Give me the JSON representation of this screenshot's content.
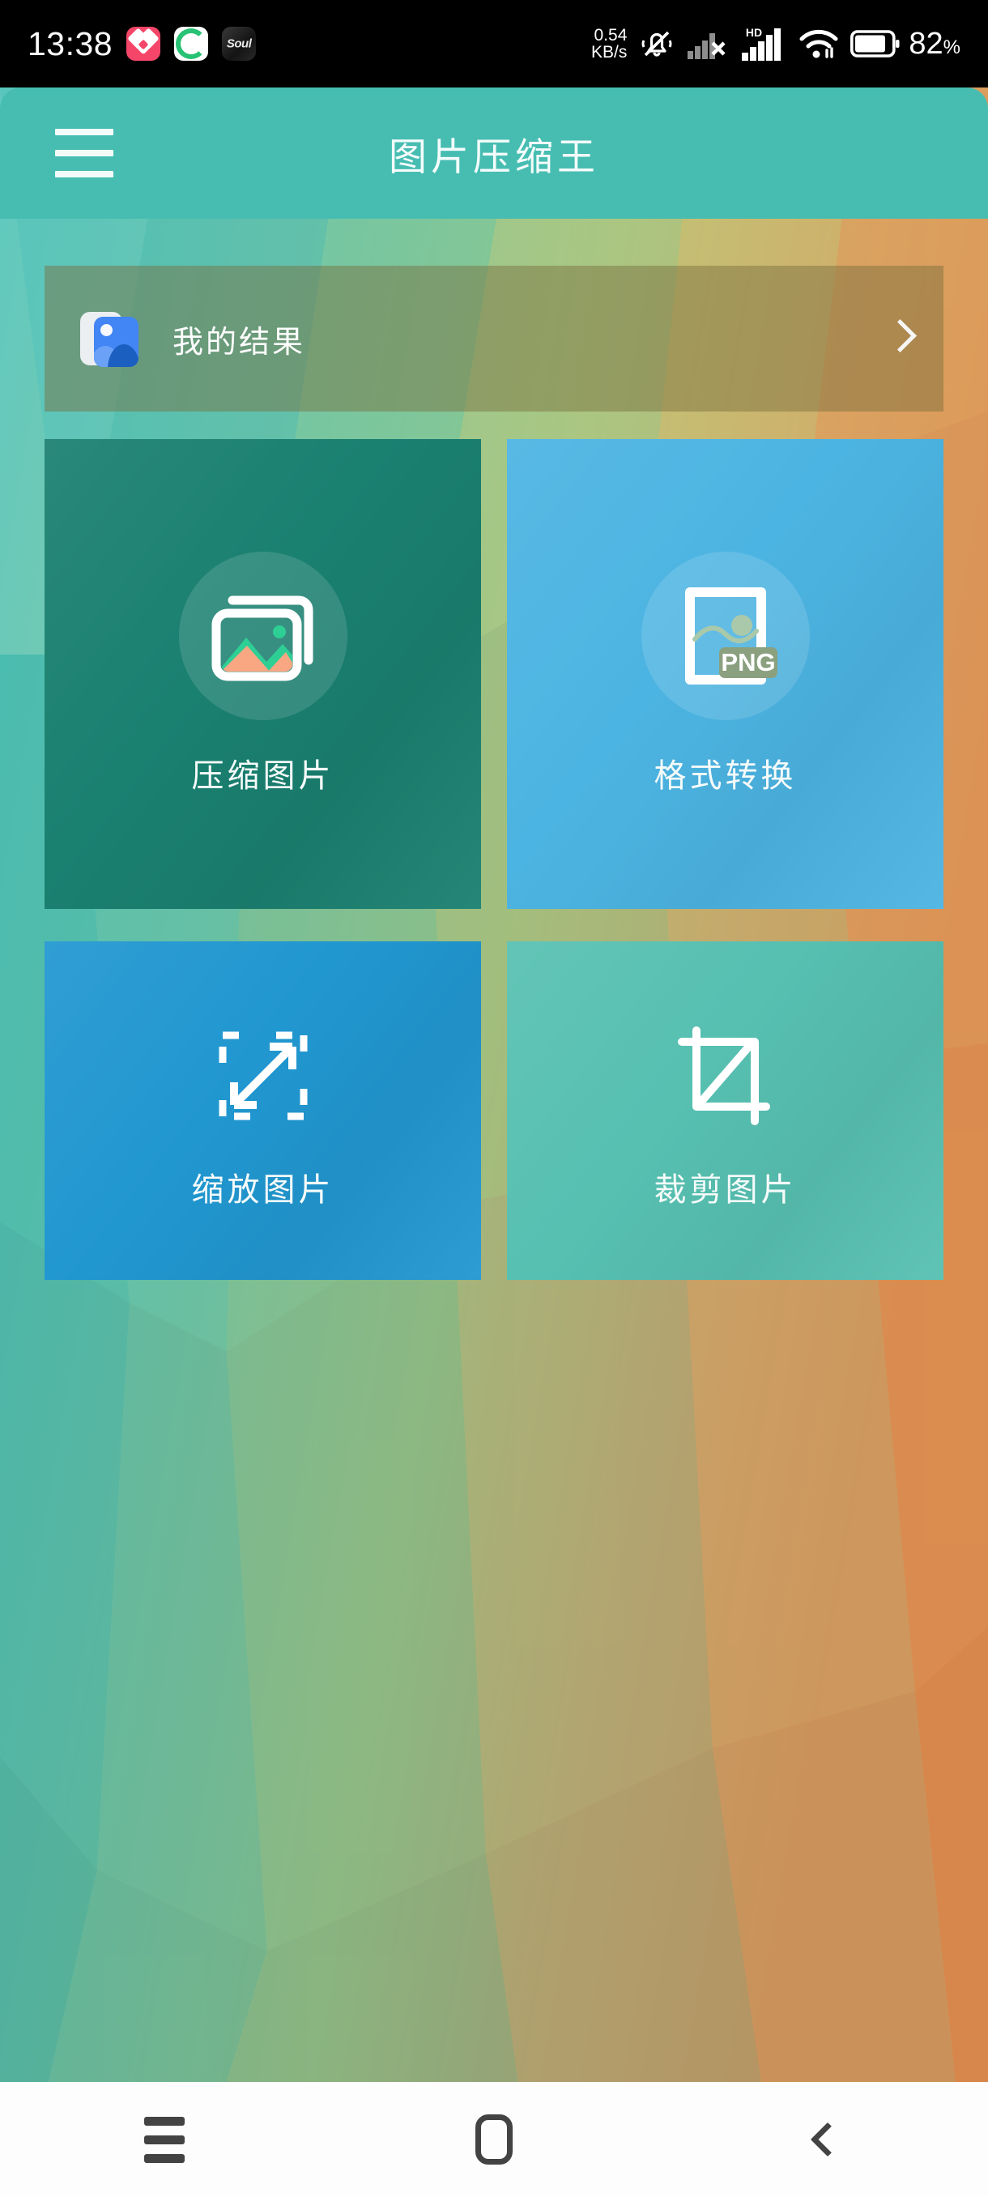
{
  "status_bar": {
    "time": "13:38",
    "app_icons": [
      "heart-app-icon",
      "green-refresh-app-icon",
      "soul-app-icon"
    ],
    "soul_label": "Soul",
    "net_speed_value": "0.54",
    "net_speed_unit": "KB/s",
    "icons": [
      "mute-bell-icon",
      "sim1-signal-no-service-icon",
      "sim2-signal-icon",
      "wifi-icon",
      "battery-icon"
    ],
    "volte_label": "HD",
    "battery_percent": "82",
    "battery_percent_symbol": "%"
  },
  "app_bar": {
    "menu_icon": "hamburger-menu-icon",
    "title": "图片压缩王"
  },
  "results_banner": {
    "icon": "gallery-photos-icon",
    "label": "我的结果",
    "chevron_icon": "chevron-right-icon"
  },
  "tiles": [
    {
      "label": "压缩图片",
      "icon": "stacked-photos-icon",
      "color": "#1a8070"
    },
    {
      "label": "格式转换",
      "icon": "image-format-png-icon",
      "badge": "PNG",
      "color": "#4cb4e2"
    },
    {
      "label": "缩放图片",
      "icon": "resize-expand-arrows-icon",
      "color": "#2197d0"
    },
    {
      "label": "裁剪图片",
      "icon": "crop-tool-icon",
      "color": "#57c0b1"
    }
  ],
  "nav_bar": {
    "recents": "recents-icon",
    "home": "home-icon",
    "back": "back-icon"
  },
  "colors": {
    "app_bar": "#47bdb2",
    "tile_compress": "#1a8070",
    "tile_convert": "#4cb4e2",
    "tile_resize": "#2197d0",
    "tile_crop": "#57c0b1",
    "banner_overlay": "rgba(120,108,60,.46)"
  }
}
